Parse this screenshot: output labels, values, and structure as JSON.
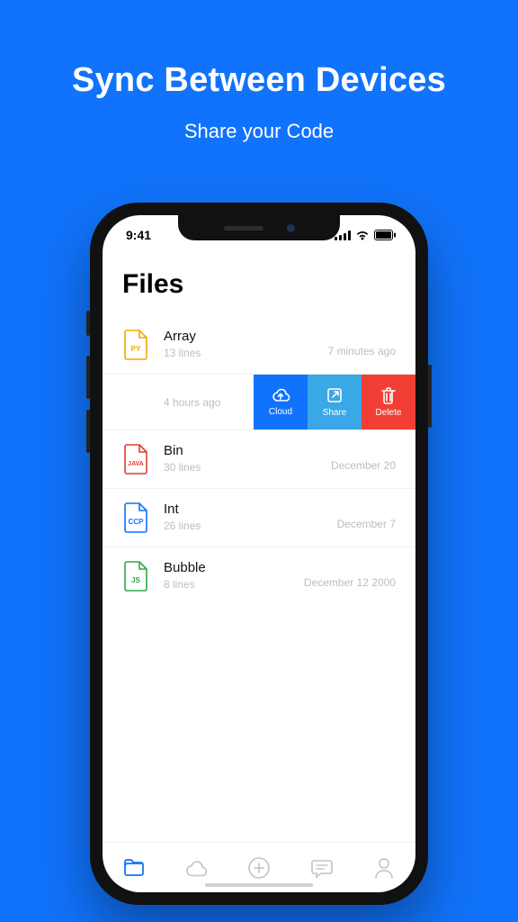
{
  "hero": {
    "title": "Sync Between Devices",
    "subtitle": "Share your Code"
  },
  "statusbar": {
    "time": "9:41"
  },
  "page_title": "Files",
  "files": [
    {
      "icon_label": "PY",
      "icon_color": "#f0a800",
      "name": "Array",
      "meta": "13 lines",
      "time": "7 minutes ago"
    },
    {
      "icon_label": "JAVA",
      "icon_color": "#e43b2f",
      "name": "Bin",
      "meta": "30 lines",
      "time": "December 20"
    },
    {
      "icon_label": "CCP",
      "icon_color": "#1173fb",
      "name": "Int",
      "meta": "26 lines",
      "time": "December 7"
    },
    {
      "icon_label": "JS",
      "icon_color": "#2ea74a",
      "name": "Bubble",
      "meta": "8 lines",
      "time": "December 12  2000"
    }
  ],
  "swipe": {
    "time": "4 hours ago",
    "actions": {
      "cloud": "Cloud",
      "share": "Share",
      "delete": "Delete"
    }
  },
  "colors": {
    "accent": "#1173fb",
    "inactive": "#c9c9c9"
  }
}
